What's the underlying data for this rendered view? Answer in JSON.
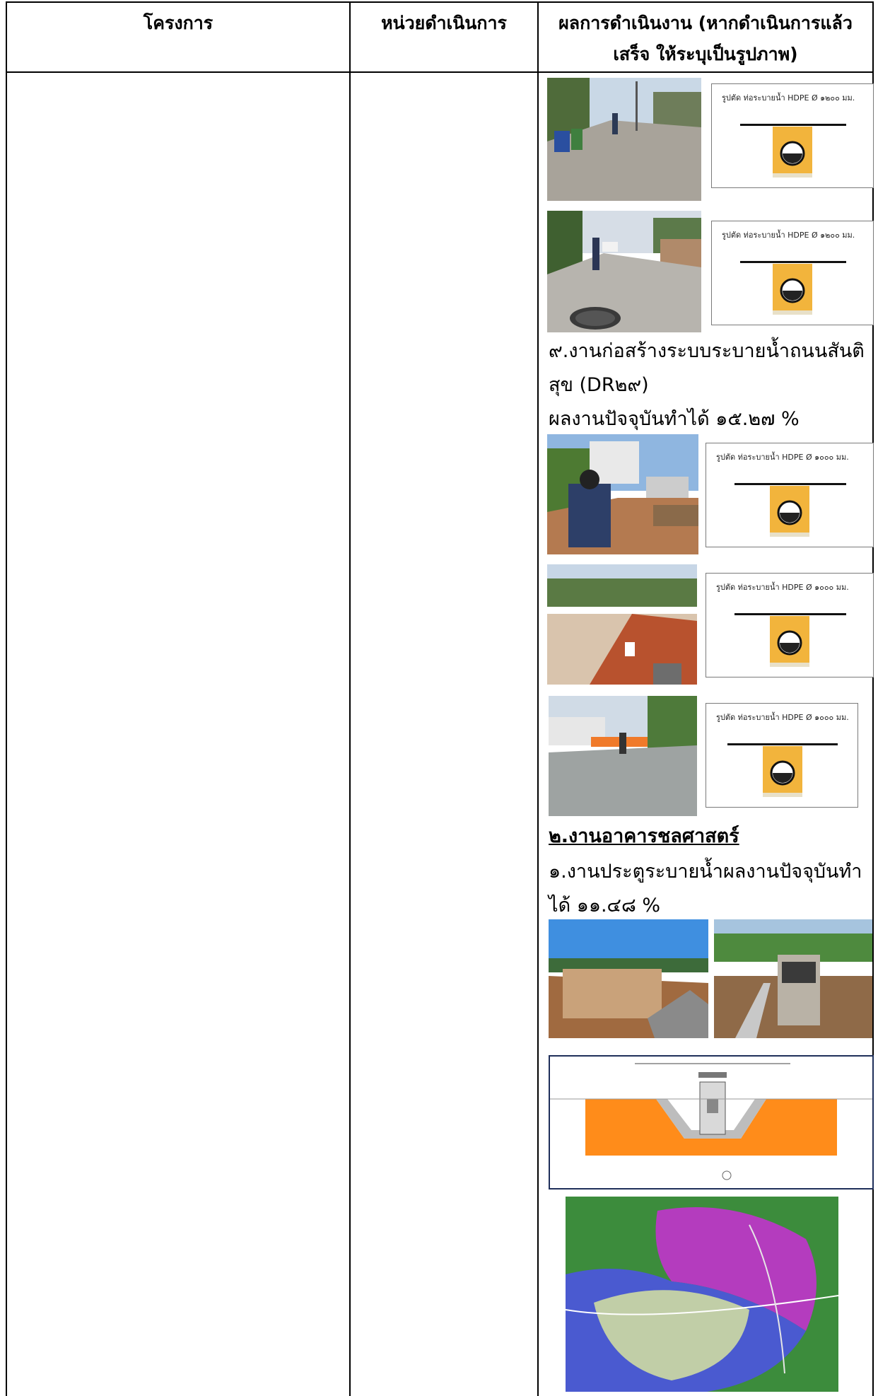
{
  "table": {
    "headers": {
      "project": "โครงการ",
      "agency": "หน่วยดำเนินการ",
      "result_line1": "ผลการดำเนินงาน (หากดำเนินการแล้ว",
      "result_line2": "เสร็จ ให้ระบุเป็นรูปภาพ)"
    }
  },
  "section_labels": {
    "pipe_1200": "รูปตัด ท่อระบายน้ำ HDPE Ø ๑๒๐๐ มม.",
    "pipe_1000": "รูปตัด ท่อระบายน้ำ HDPE Ø ๑๐๐๐ มม."
  },
  "content": {
    "item9_line1": "๙.งานก่อสร้างระบบระบายน้ำถนนสันติ",
    "item9_line2": "สุข (DR๒๙)",
    "item9_progress": "ผลงานปัจจุบันทำได้  ๑๕.๒๗ %",
    "section2_heading": "๒.งานอาคารชลศาสตร์",
    "item1_line1": "๑.งานประตูระบายน้ำผลงานปัจจุบันทำ",
    "item1_line2": "ได้  ๑๑.๔๘ %"
  },
  "colors": {
    "border": "#000000",
    "pipe_fill": "#f2b43c",
    "soil_orange": "#ff8c1a",
    "map_purple": "#b43cbe",
    "map_blue": "#4a5ad0",
    "map_green": "#3c8c3c"
  }
}
